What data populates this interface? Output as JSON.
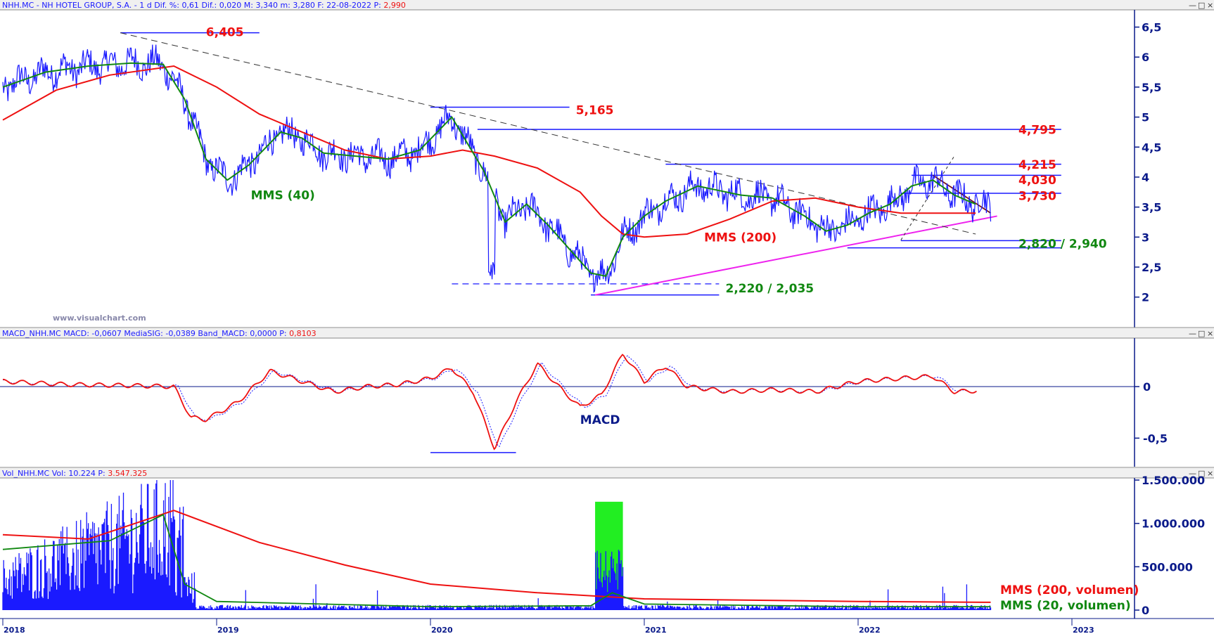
{
  "panels": {
    "price": {
      "header": "NHH.MC - NH HOTEL GROUP, S.A. - 1 d",
      "stats": [
        {
          "k": "Dif. %:",
          "v": "0,61"
        },
        {
          "k": "Dif.:",
          "v": "0,020"
        },
        {
          "k": "M:",
          "v": "3,340"
        },
        {
          "k": "m:",
          "v": "3,280"
        },
        {
          "k": "F:",
          "v": "22-08-2022"
        },
        {
          "k": "P:",
          "v": "2,990"
        }
      ],
      "watermark": "www.visualchart.com"
    },
    "macd": {
      "header": "MACD_NHH.MC",
      "stats": [
        {
          "k": "MACD:",
          "v": "-0,0607"
        },
        {
          "k": "MediaSIG:",
          "v": "-0,0389"
        },
        {
          "k": "Band_MACD:",
          "v": "0,0000"
        },
        {
          "k": "P:",
          "v": "0,8103"
        }
      ]
    },
    "volume": {
      "header": "Vol_NHH.MC",
      "stats": [
        {
          "k": "Vol:",
          "v": "10.224"
        },
        {
          "k": "P:",
          "v": "3.547.325"
        }
      ]
    }
  },
  "window_controls": [
    "—",
    "□",
    "×"
  ],
  "colors": {
    "price": "#1a1aff",
    "mms40": "#118811",
    "mms200": "#ee1111",
    "support": "#ee22ee",
    "levels": "#1a1aff",
    "axis": "#0a1a8a",
    "label_red": "#ee1111",
    "label_green": "#118811",
    "highlight": "#22ee22"
  },
  "chart_data": [
    {
      "type": "line",
      "panel": "price",
      "x_ticks": [
        "2018",
        "2019",
        "2020",
        "2021",
        "2022",
        "2023"
      ],
      "ylim": [
        1.75,
        6.6
      ],
      "y_ticks": [
        {
          "v": 2,
          "label": "2"
        },
        {
          "v": 2.5,
          "label": "2,5"
        },
        {
          "v": 3,
          "label": "3"
        },
        {
          "v": 3.5,
          "label": "3,5"
        },
        {
          "v": 4,
          "label": "4"
        },
        {
          "v": 4.5,
          "label": "4,5"
        },
        {
          "v": 5,
          "label": "5"
        },
        {
          "v": 5.5,
          "label": "5,5"
        },
        {
          "v": 6,
          "label": "6"
        },
        {
          "v": 6.5,
          "label": "6,5"
        }
      ],
      "series": [
        {
          "name": "MMS (40)",
          "color": "#118811",
          "points": [
            [
              2018.0,
              5.5
            ],
            [
              2018.2,
              5.75
            ],
            [
              2018.4,
              5.85
            ],
            [
              2018.6,
              5.9
            ],
            [
              2018.75,
              5.88
            ],
            [
              2018.85,
              5.3
            ],
            [
              2018.95,
              4.3
            ],
            [
              2019.05,
              3.95
            ],
            [
              2019.15,
              4.2
            ],
            [
              2019.3,
              4.75
            ],
            [
              2019.4,
              4.65
            ],
            [
              2019.5,
              4.4
            ],
            [
              2019.65,
              4.35
            ],
            [
              2019.8,
              4.3
            ],
            [
              2019.95,
              4.45
            ],
            [
              2020.1,
              5.0
            ],
            [
              2020.25,
              4.1
            ],
            [
              2020.35,
              3.25
            ],
            [
              2020.45,
              3.55
            ],
            [
              2020.55,
              3.2
            ],
            [
              2020.65,
              2.8
            ],
            [
              2020.75,
              2.4
            ],
            [
              2020.82,
              2.35
            ],
            [
              2020.9,
              3.0
            ],
            [
              2021.0,
              3.35
            ],
            [
              2021.1,
              3.6
            ],
            [
              2021.25,
              3.85
            ],
            [
              2021.45,
              3.7
            ],
            [
              2021.6,
              3.65
            ],
            [
              2021.75,
              3.35
            ],
            [
              2021.85,
              3.1
            ],
            [
              2021.95,
              3.2
            ],
            [
              2022.05,
              3.4
            ],
            [
              2022.15,
              3.55
            ],
            [
              2022.25,
              3.85
            ],
            [
              2022.35,
              3.95
            ],
            [
              2022.45,
              3.7
            ],
            [
              2022.55,
              3.55
            ]
          ]
        },
        {
          "name": "MMS (200)",
          "color": "#ee1111",
          "points": [
            [
              2018.0,
              4.95
            ],
            [
              2018.25,
              5.45
            ],
            [
              2018.5,
              5.7
            ],
            [
              2018.8,
              5.85
            ],
            [
              2019.0,
              5.5
            ],
            [
              2019.2,
              5.05
            ],
            [
              2019.4,
              4.75
            ],
            [
              2019.6,
              4.45
            ],
            [
              2019.8,
              4.3
            ],
            [
              2020.0,
              4.35
            ],
            [
              2020.15,
              4.45
            ],
            [
              2020.3,
              4.35
            ],
            [
              2020.5,
              4.15
            ],
            [
              2020.7,
              3.75
            ],
            [
              2020.8,
              3.35
            ],
            [
              2020.9,
              3.05
            ],
            [
              2021.0,
              3.0
            ],
            [
              2021.2,
              3.05
            ],
            [
              2021.4,
              3.3
            ],
            [
              2021.6,
              3.6
            ],
            [
              2021.8,
              3.65
            ],
            [
              2022.0,
              3.5
            ],
            [
              2022.2,
              3.4
            ],
            [
              2022.4,
              3.4
            ],
            [
              2022.55,
              3.4
            ]
          ]
        }
      ],
      "annotations": [
        {
          "text": "6,405",
          "color": "#ee1111"
        },
        {
          "text": "5,165",
          "color": "#ee1111"
        },
        {
          "text": "4,795",
          "color": "#ee1111"
        },
        {
          "text": "4,215",
          "color": "#ee1111"
        },
        {
          "text": "4,030",
          "color": "#ee1111"
        },
        {
          "text": "3,730",
          "color": "#ee1111"
        },
        {
          "text": "2,820 / 2,940",
          "color": "#118811"
        },
        {
          "text": "2,220 / 2,035",
          "color": "#118811"
        },
        {
          "text": "MMS (40)",
          "color": "#118811"
        },
        {
          "text": "MMS (200)",
          "color": "#ee1111"
        }
      ]
    },
    {
      "type": "line",
      "panel": "macd",
      "ylim": [
        -0.75,
        0.45
      ],
      "y_ticks": [
        {
          "v": 0,
          "label": "0"
        },
        {
          "v": -0.5,
          "label": "-0,5"
        }
      ],
      "series": [
        {
          "name": "MACD",
          "color": "#ee1111",
          "points": [
            [
              2018.0,
              0.05
            ],
            [
              2018.3,
              0.02
            ],
            [
              2018.6,
              0.01
            ],
            [
              2018.8,
              0.0
            ],
            [
              2018.88,
              -0.3
            ],
            [
              2018.95,
              -0.32
            ],
            [
              2019.1,
              -0.15
            ],
            [
              2019.25,
              0.15
            ],
            [
              2019.4,
              0.05
            ],
            [
              2019.55,
              -0.05
            ],
            [
              2019.7,
              0.0
            ],
            [
              2019.85,
              0.02
            ],
            [
              2020.0,
              0.08
            ],
            [
              2020.1,
              0.18
            ],
            [
              2020.2,
              -0.05
            ],
            [
              2020.3,
              -0.6
            ],
            [
              2020.4,
              -0.15
            ],
            [
              2020.5,
              0.22
            ],
            [
              2020.6,
              0.0
            ],
            [
              2020.7,
              -0.2
            ],
            [
              2020.8,
              -0.08
            ],
            [
              2020.9,
              0.32
            ],
            [
              2021.0,
              0.05
            ],
            [
              2021.1,
              0.2
            ],
            [
              2021.2,
              0.0
            ],
            [
              2021.4,
              -0.05
            ],
            [
              2021.6,
              -0.03
            ],
            [
              2021.8,
              -0.05
            ],
            [
              2022.0,
              0.05
            ],
            [
              2022.2,
              0.08
            ],
            [
              2022.35,
              0.1
            ],
            [
              2022.45,
              -0.05
            ],
            [
              2022.55,
              -0.04
            ]
          ]
        }
      ],
      "annotations": [
        {
          "text": "MACD",
          "color": "#0a1a8a"
        }
      ]
    },
    {
      "type": "bar",
      "panel": "volume",
      "ylim": [
        0,
        1500000
      ],
      "y_ticks": [
        {
          "v": 0,
          "label": "0"
        },
        {
          "v": 500000,
          "label": "500.000"
        },
        {
          "v": 1000000,
          "label": "1.000.000"
        },
        {
          "v": 1500000,
          "label": "1.500.000"
        }
      ],
      "series": [
        {
          "name": "MMS (200, volumen)",
          "color": "#ee1111"
        },
        {
          "name": "MMS (20, volumen)",
          "color": "#118811"
        }
      ],
      "highlight_range": [
        2020.77,
        2020.9
      ]
    }
  ]
}
